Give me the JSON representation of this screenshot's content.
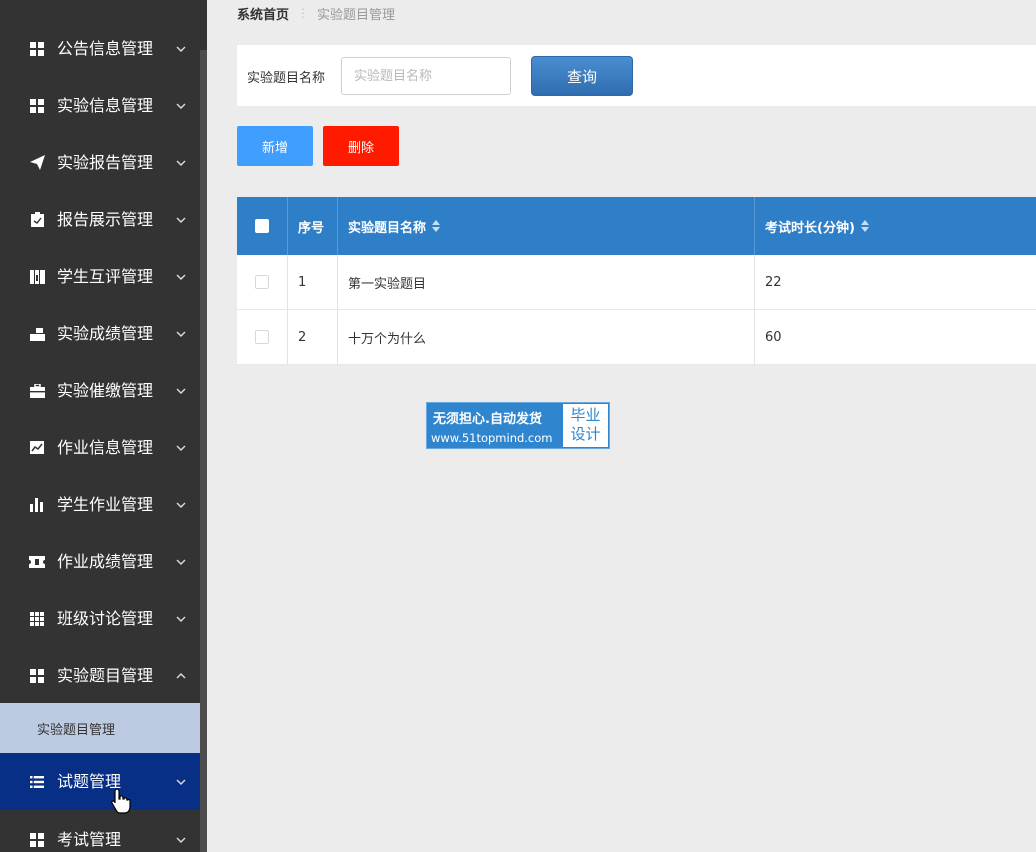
{
  "sidebar": {
    "menu": [
      {
        "label": "公告信息管理",
        "icon": "grid-icon",
        "expanded": false
      },
      {
        "label": "实验信息管理",
        "icon": "grid-icon",
        "expanded": false
      },
      {
        "label": "实验报告管理",
        "icon": "paper-plane-icon",
        "expanded": false
      },
      {
        "label": "报告展示管理",
        "icon": "clipboard-icon",
        "expanded": false
      },
      {
        "label": "学生互评管理",
        "icon": "columns-icon",
        "expanded": false
      },
      {
        "label": "实验成绩管理",
        "icon": "money-hand-icon",
        "expanded": false
      },
      {
        "label": "实验催缴管理",
        "icon": "briefcase-icon",
        "expanded": false
      },
      {
        "label": "作业信息管理",
        "icon": "line-chart-icon",
        "expanded": false
      },
      {
        "label": "学生作业管理",
        "icon": "bar-chart-icon",
        "expanded": false
      },
      {
        "label": "作业成绩管理",
        "icon": "ticket-icon",
        "expanded": false
      },
      {
        "label": "班级讨论管理",
        "icon": "table-grid-icon",
        "expanded": false
      },
      {
        "label": "实验题目管理",
        "icon": "grid-icon",
        "expanded": true
      },
      {
        "label": "试题管理",
        "icon": "list-icon",
        "expanded": false,
        "active": true
      },
      {
        "label": "考试管理",
        "icon": "grid-icon",
        "expanded": false
      }
    ],
    "submenu_label": "实验题目管理"
  },
  "breadcrumb": {
    "home": "系统首页",
    "separator": "⋮",
    "current": "实验题目管理"
  },
  "search": {
    "label": "实验题目名称",
    "placeholder": "实验题目名称",
    "value": "",
    "button_label": "查询"
  },
  "actions": {
    "add_label": "新增",
    "delete_label": "删除"
  },
  "table": {
    "headers": {
      "index": "序号",
      "name": "实验题目名称",
      "duration": "考试时长(分钟)"
    },
    "rows": [
      {
        "index": "1",
        "name": "第一实验题目",
        "duration": "22"
      },
      {
        "index": "2",
        "name": "十万个为什么",
        "duration": "60"
      }
    ]
  },
  "badge": {
    "line1": "无须担心.自动发货",
    "line2": "www.51topmind.com",
    "box_line1": "毕业",
    "box_line2": "设计"
  },
  "colors": {
    "sidebar_bg": "#333333",
    "active_menu_bg": "#082f86",
    "submenu_bg": "#bccbe2",
    "table_header_bg": "#2f7fc8",
    "add_button": "#409eff",
    "delete_button": "#ff1a00",
    "query_button": "#3a7bc2"
  }
}
